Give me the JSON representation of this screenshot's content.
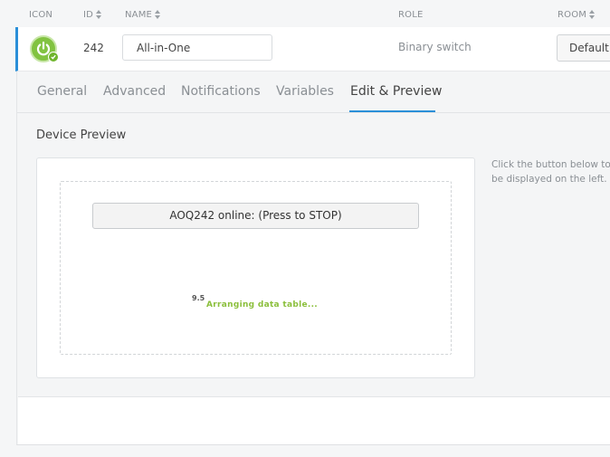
{
  "header": {
    "icon": "ICON",
    "id": "ID",
    "name": "NAME",
    "role": "ROLE",
    "room": "ROOM"
  },
  "device": {
    "icon_name": "power-switch-icon",
    "status_color": "#82c341",
    "id": "242",
    "name": "All-in-One",
    "role": "Binary switch",
    "room": "Default"
  },
  "tabs": [
    {
      "label": "General",
      "active": false
    },
    {
      "label": "Advanced",
      "active": false
    },
    {
      "label": "Notifications",
      "active": false
    },
    {
      "label": "Variables",
      "active": false
    },
    {
      "label": "Edit & Preview",
      "active": true
    }
  ],
  "preview": {
    "title": "Device Preview",
    "button_label": "AOQ242 online: (Press to STOP)",
    "meta_number": "9.5",
    "meta_message": "Arranging data table...",
    "hint_line1": "Click the button below to",
    "hint_line2": "be displayed on the left."
  },
  "colors": {
    "accent": "#2a8fd8",
    "success": "#82c341"
  }
}
